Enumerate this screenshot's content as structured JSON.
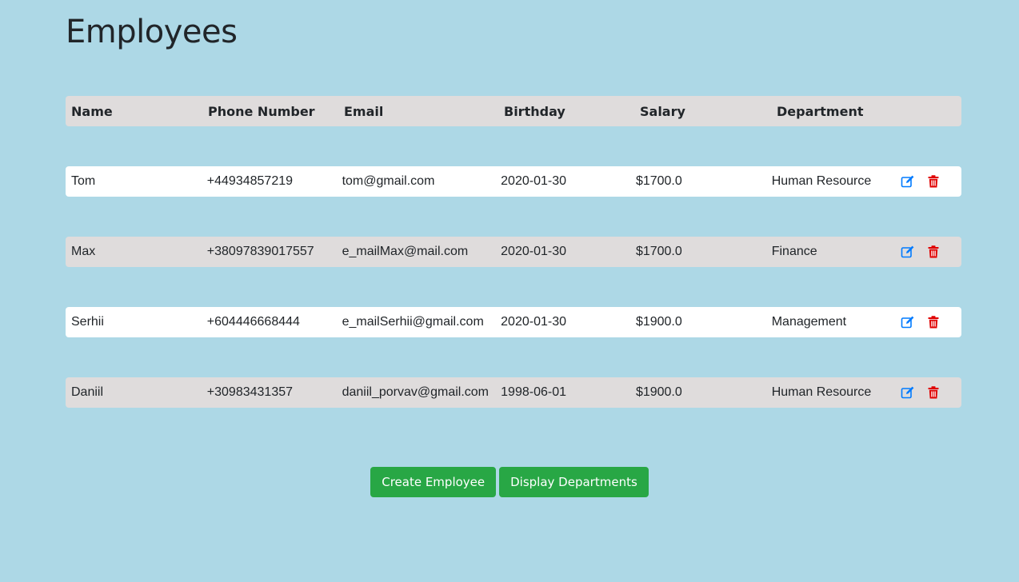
{
  "page": {
    "title": "Employees"
  },
  "table": {
    "headers": [
      "Name",
      "Phone Number",
      "Email",
      "Birthday",
      "Salary",
      "Department"
    ],
    "rows": [
      {
        "name": "Tom",
        "phone": "+44934857219",
        "email": "tom@gmail.com",
        "birthday": "2020-01-30",
        "salary": "$1700.0",
        "department": "Human Resource"
      },
      {
        "name": "Max",
        "phone": "+38097839017557",
        "email": "e_mailMax@mail.com",
        "birthday": "2020-01-30",
        "salary": "$1700.0",
        "department": "Finance"
      },
      {
        "name": "Serhii",
        "phone": "+604446668444",
        "email": "e_mailSerhii@gmail.com",
        "birthday": "2020-01-30",
        "salary": "$1900.0",
        "department": "Management"
      },
      {
        "name": "Daniil",
        "phone": "+30983431357",
        "email": "daniil_porvav@gmail.com",
        "birthday": "1998-06-01",
        "salary": "$1900.0",
        "department": "Human Resource"
      }
    ],
    "row_actions": {
      "edit_icon": "edit-icon",
      "delete_icon": "trash-icon"
    }
  },
  "actions": {
    "create_label": "Create Employee",
    "departments_label": "Display Departments"
  },
  "colors": {
    "background": "#add8e6",
    "row_gray": "#dfdcdc",
    "row_white": "#ffffff",
    "edit": "#007bff",
    "delete": "#e00000",
    "button": "#28a745"
  }
}
